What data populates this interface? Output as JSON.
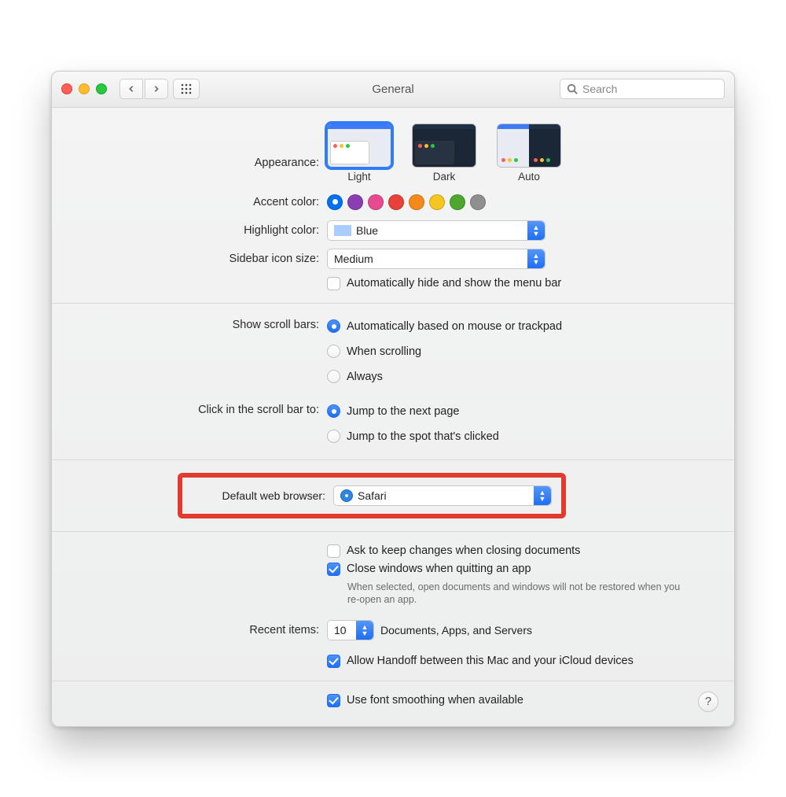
{
  "window": {
    "title": "General"
  },
  "search": {
    "placeholder": "Search"
  },
  "labels": {
    "appearance": "Appearance:",
    "accent": "Accent color:",
    "highlight": "Highlight color:",
    "sidebarIcon": "Sidebar icon size:",
    "scrollBars": "Show scroll bars:",
    "clickScroll": "Click in the scroll bar to:",
    "defaultBrowser": "Default web browser:",
    "recent": "Recent items:"
  },
  "appearance": {
    "options": [
      {
        "label": "Light",
        "selected": true
      },
      {
        "label": "Dark",
        "selected": false
      },
      {
        "label": "Auto",
        "selected": false
      }
    ]
  },
  "accentColors": [
    {
      "name": "blue",
      "hex": "#0070f2",
      "selected": true
    },
    {
      "name": "purple",
      "hex": "#8a3eb2",
      "selected": false
    },
    {
      "name": "pink",
      "hex": "#e64b91",
      "selected": false
    },
    {
      "name": "red",
      "hex": "#e8413a",
      "selected": false
    },
    {
      "name": "orange",
      "hex": "#f5891a",
      "selected": false
    },
    {
      "name": "yellow",
      "hex": "#f6c51f",
      "selected": false
    },
    {
      "name": "green",
      "hex": "#4ea72e",
      "selected": false
    },
    {
      "name": "gray",
      "hex": "#8f8f8f",
      "selected": false
    }
  ],
  "highlight": {
    "value": "Blue"
  },
  "sidebarIcon": {
    "value": "Medium"
  },
  "autoHideMenuBar": {
    "checked": false,
    "label": "Automatically hide and show the menu bar"
  },
  "scrollBars": {
    "options": [
      {
        "label": "Automatically based on mouse or trackpad",
        "checked": true
      },
      {
        "label": "When scrolling",
        "checked": false
      },
      {
        "label": "Always",
        "checked": false
      }
    ]
  },
  "clickScroll": {
    "options": [
      {
        "label": "Jump to the next page",
        "checked": true
      },
      {
        "label": "Jump to the spot that's clicked",
        "checked": false
      }
    ]
  },
  "defaultBrowser": {
    "value": "Safari"
  },
  "checkboxes": {
    "askKeepChanges": {
      "checked": false,
      "label": "Ask to keep changes when closing documents"
    },
    "closeWindows": {
      "checked": true,
      "label": "Close windows when quitting an app",
      "note": "When selected, open documents and windows will not be restored when you re-open an app."
    }
  },
  "recent": {
    "value": "10",
    "suffix": "Documents, Apps, and Servers"
  },
  "handoff": {
    "checked": true,
    "label": "Allow Handoff between this Mac and your iCloud devices"
  },
  "fontSmoothing": {
    "checked": true,
    "label": "Use font smoothing when available"
  },
  "help": {
    "label": "?"
  }
}
